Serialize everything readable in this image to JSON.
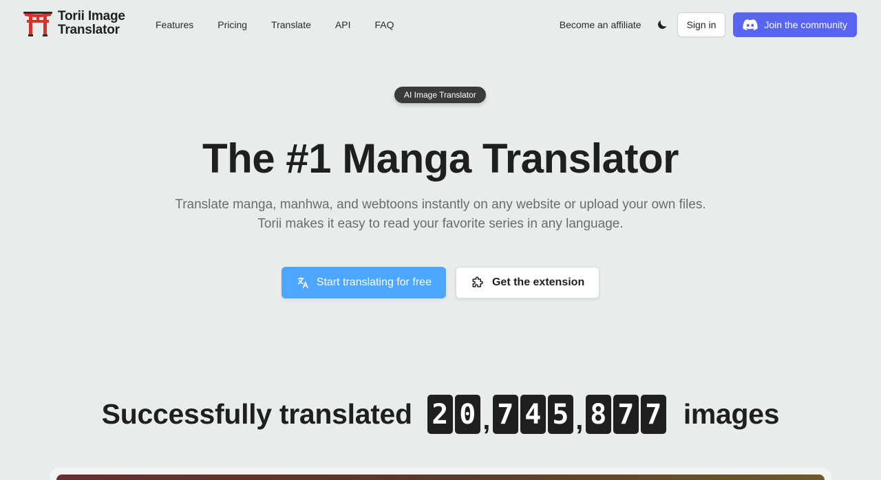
{
  "brand": {
    "name_line1": "Torii Image",
    "name_line2": "Translator",
    "logo_color": "#d6332b"
  },
  "nav": {
    "items": [
      {
        "label": "Features"
      },
      {
        "label": "Pricing"
      },
      {
        "label": "Translate"
      },
      {
        "label": "API"
      },
      {
        "label": "FAQ"
      }
    ]
  },
  "header_right": {
    "affiliate_label": "Become an affiliate",
    "theme_icon": "moon-icon",
    "signin_label": "Sign in",
    "discord_label": "Join the community",
    "discord_color": "#5865f2"
  },
  "hero": {
    "badge": "AI Image Translator",
    "title": "The #1 Manga Translator",
    "subtitle": "Translate manga, manhwa, and webtoons instantly on any website or upload your own files. Torii makes it easy to read your favorite series in any language.",
    "primary_cta": "Start translating for free",
    "primary_icon": "translate-icon",
    "primary_color": "#4da6ff",
    "secondary_cta": "Get the extension",
    "secondary_icon": "puzzle-icon"
  },
  "counter": {
    "prefix": "Successfully translated",
    "suffix": "images",
    "digits": [
      "2",
      "0",
      ",",
      "7",
      "4",
      "5",
      ",",
      "8",
      "7",
      "7"
    ]
  }
}
